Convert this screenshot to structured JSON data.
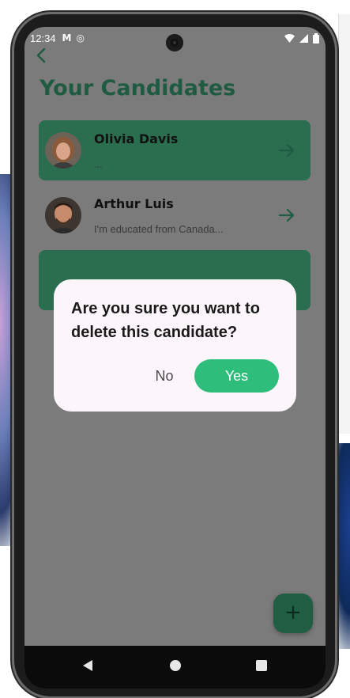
{
  "status_bar": {
    "time": "12:34",
    "left_icons": [
      "gmail-icon",
      "sync-icon"
    ],
    "right_icons": [
      "wifi-icon",
      "signal-icon",
      "battery-icon"
    ]
  },
  "header": {
    "title": "Your Candidates"
  },
  "candidates": [
    {
      "name": "Olivia Davis",
      "snippet": "..."
    },
    {
      "name": "Arthur Luis",
      "snippet": "I'm educated from Canada..."
    },
    {
      "name": "",
      "snippet": ""
    }
  ],
  "dialog": {
    "message": "Are you sure you want to delete this candidate?",
    "no_label": "No",
    "yes_label": "Yes"
  },
  "fab": {
    "icon": "plus-icon",
    "label": "+"
  },
  "colors": {
    "accent": "#1e5b41",
    "card": "#2a6d4f",
    "yes_button": "#2ebd7b",
    "scrim": "#7b7b7b"
  }
}
